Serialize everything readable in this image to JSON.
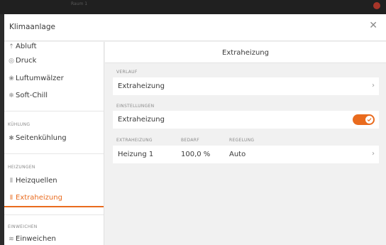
{
  "bg_window": {
    "title": "Raum 1"
  },
  "window": {
    "title": "Klimaanlage"
  },
  "colors": {
    "accent": "#e96b1e",
    "text": "#3a3a3a",
    "muted": "#8a8a8a"
  },
  "sidebar": {
    "items_top": [
      {
        "label": "Abluft",
        "icon": "exhaust-icon"
      },
      {
        "label": "Druck",
        "icon": "pressure-icon"
      },
      {
        "label": "Luftumwälzer",
        "icon": "fan-icon"
      },
      {
        "label": "Soft-Chill",
        "icon": "soft-chill-icon"
      }
    ],
    "section_cooling": "KÜHLUNG",
    "item_cooling": {
      "label": "Seitenkühlung",
      "icon": "side-cooling-icon"
    },
    "section_heating": "HEIZUNGEN",
    "items_heating": [
      {
        "label": "Heizquellen",
        "icon": "heating-icon"
      },
      {
        "label": "Extraheizung",
        "icon": "heating-icon",
        "active": true
      }
    ],
    "section_soak": "EINWEICHEN",
    "item_soak": {
      "label": "Einweichen",
      "icon": "soak-icon"
    }
  },
  "main": {
    "title": "Extraheizung",
    "history": {
      "section": "VERLAUF",
      "row_label": "Extraheizung"
    },
    "settings": {
      "section": "EINSTELLUNGEN",
      "row_label": "Extraheizung",
      "toggle_on": true
    },
    "table": {
      "headers": [
        "EXTRAHEIZUNG",
        "BEDARF",
        "REGELUNG"
      ],
      "rows": [
        {
          "name": "Heizung 1",
          "demand": "100,0 %",
          "control": "Auto"
        }
      ]
    }
  }
}
